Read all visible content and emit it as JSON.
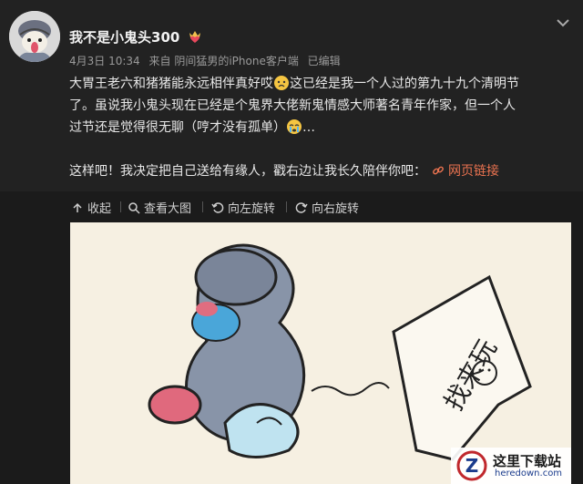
{
  "post": {
    "username": "我不是小鬼头300",
    "badge_icon": "crown-heart-icon",
    "date": "4月3日 10:34",
    "source": "来自 阴间猛男的iPhone客户端",
    "edited": "已编辑",
    "text_line1": "大胃王老六和猪猪能永远相伴真好哎",
    "text_line1_b": "这已经是我一个人过的第九十九个清明节",
    "text_line2": "了。虽说我小鬼头现在已经是个鬼界大佬新鬼情感大师著名青年作家，但一个人",
    "text_line3": "过节还是觉得很无聊（哼才没有孤单）",
    "text_line3_b": "…",
    "text_line4": "这样吧！我决定把自己送给有缘人，戳右边让我长久陪伴你吧：",
    "link_label": "网页链接",
    "link_icon": "link-icon",
    "emoji1": "sad-face-emoji",
    "emoji2": "crying-face-emoji"
  },
  "toolbar": {
    "collapse": "收起",
    "view_large": "查看大图",
    "rotate_left": "向左旋转",
    "rotate_right": "向右旋转"
  },
  "image": {
    "sign_text": "找来玩"
  },
  "watermark": {
    "title": "这里下载站",
    "url": "heredown.com",
    "logo_letter": "Z"
  },
  "colors": {
    "background": "#1b1b1b",
    "link": "#eb7350",
    "muted": "#9a9a9a"
  }
}
